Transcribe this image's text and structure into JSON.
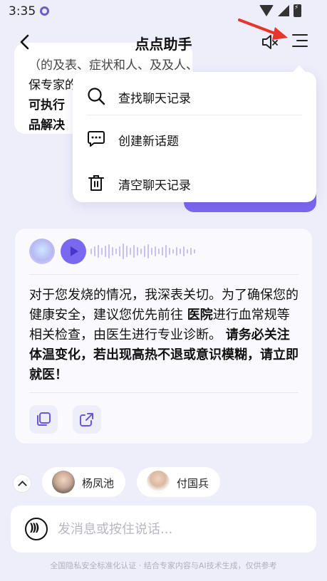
{
  "status_bar": {
    "time": "3:35"
  },
  "header": {
    "title": "点点助手"
  },
  "previous_card": {
    "lines": [
      "（的及表、症状和人、及及人、瑞措人、就",
      "保专家的专一个建议，帮您转化为三安的",
      "可执行",
      "品解决"
    ]
  },
  "menu": {
    "items": [
      {
        "label": "查找聊天记录",
        "icon": "search-icon"
      },
      {
        "label": "创建新话题",
        "icon": "chat-bubble-icon"
      },
      {
        "label": "清空聊天记录",
        "icon": "trash-icon"
      }
    ]
  },
  "answer": {
    "segments": [
      {
        "text": "对于您发烧的情况，我深表关切。为了确保您的健康安全，建议您优先前往 ",
        "bold": false
      },
      {
        "text": "医院",
        "bold": true
      },
      {
        "text": "进行血常规等相关检查，由医生进行专业诊断。 ",
        "bold": false
      },
      {
        "text": "请务必关注体温变化，若出现高热不退或意识模糊，请立即就医！",
        "bold": true
      }
    ]
  },
  "experts": [
    {
      "name": "杨凤池"
    },
    {
      "name": "付国兵"
    }
  ],
  "input": {
    "placeholder": "发消息或按住说话..."
  },
  "footer": {
    "note": "全国隐私安全标准化认证 · 结合专家内容与AI技术生成，仅供参考"
  },
  "colors": {
    "accent": "#7b68f0",
    "background": "#eeeefb",
    "annotation_arrow": "#e8352b"
  }
}
